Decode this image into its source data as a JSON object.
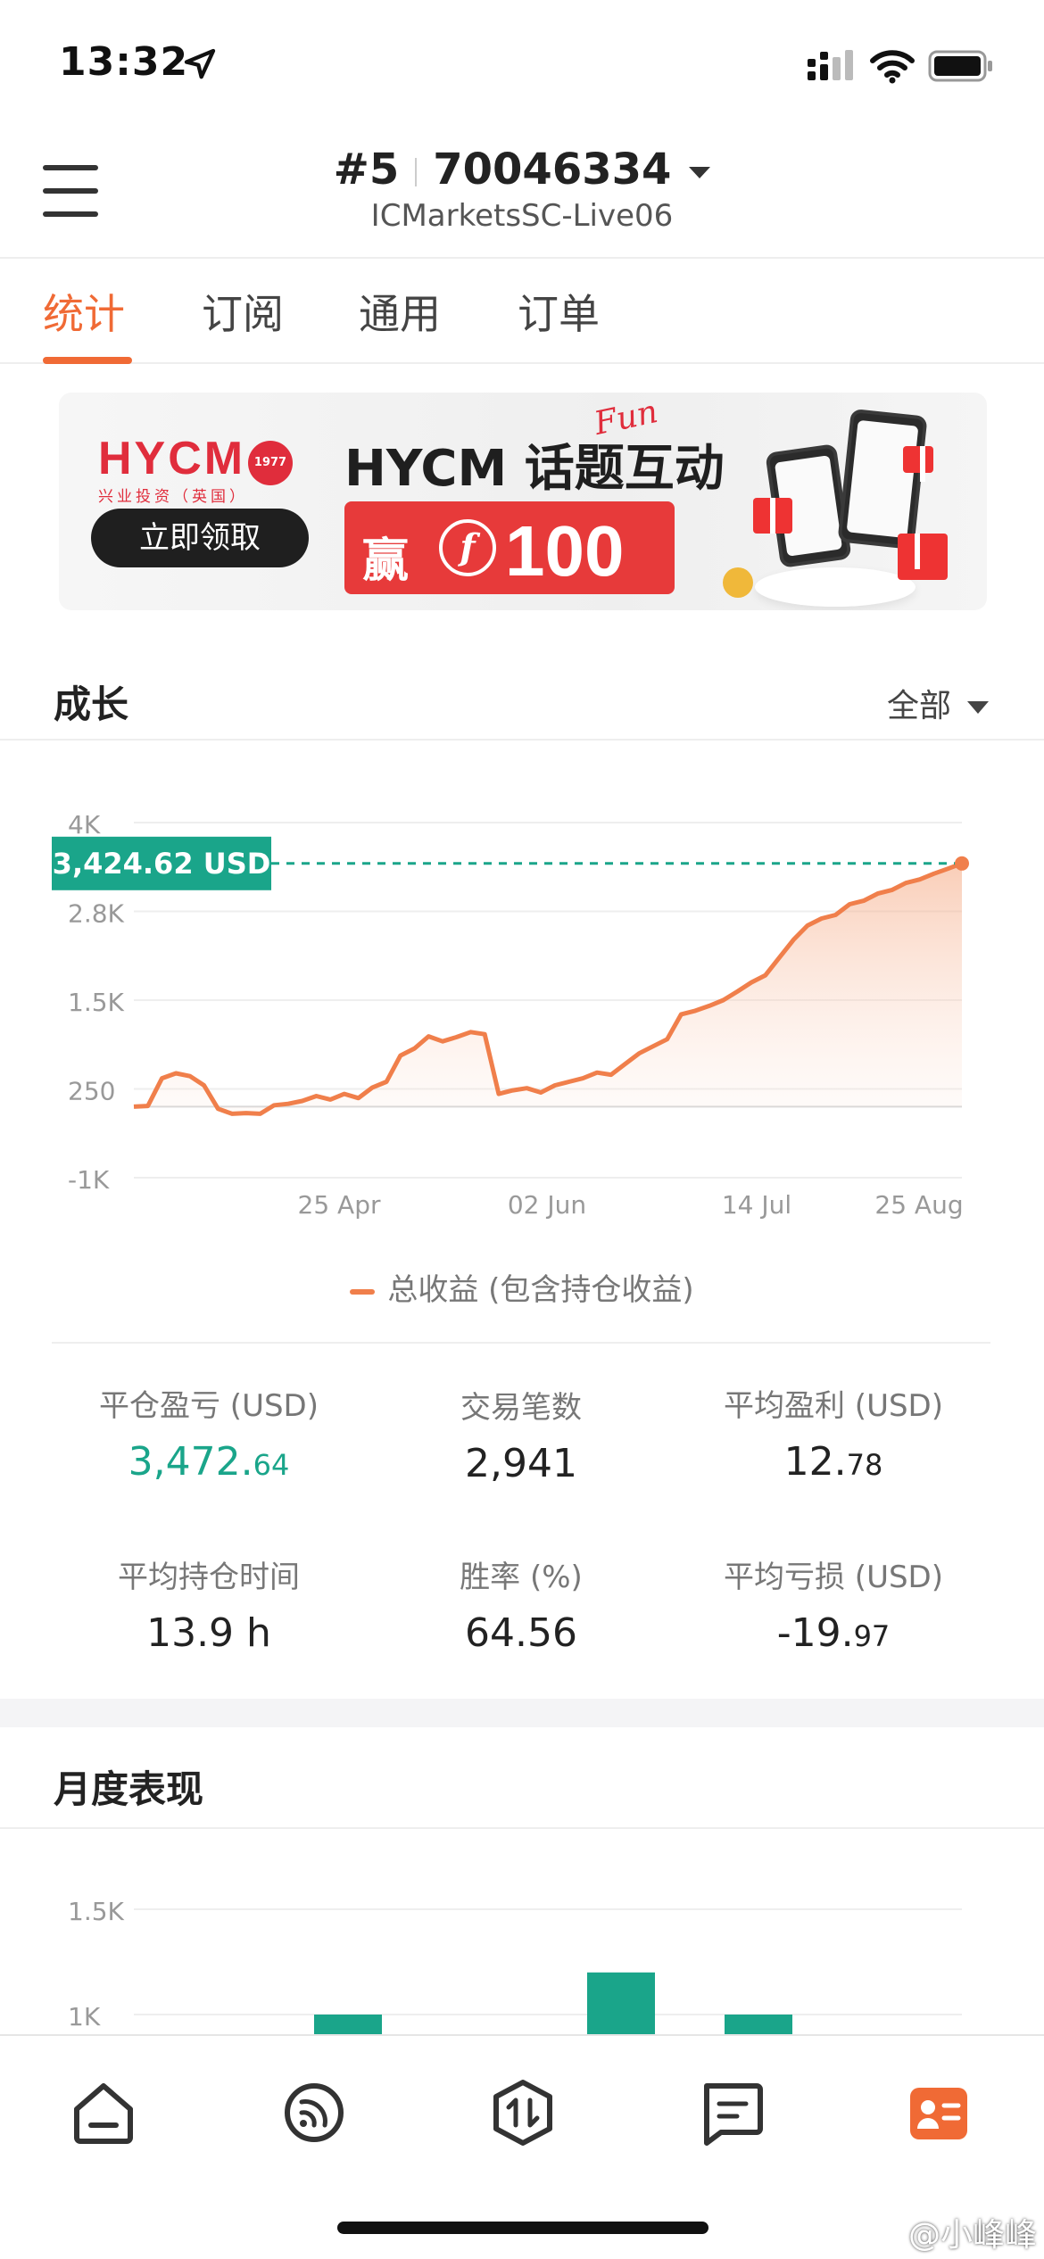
{
  "status_bar": {
    "time": "13:32",
    "icons": [
      "location-arrow-icon",
      "cellular-signal-icon",
      "wifi-icon",
      "battery-icon"
    ]
  },
  "header": {
    "account_index": "#5",
    "account_number": "70046334",
    "server": "ICMarketsSC-Live06"
  },
  "tabs": [
    {
      "label": "统计",
      "active": true
    },
    {
      "label": "订阅",
      "active": false
    },
    {
      "label": "通用",
      "active": false
    },
    {
      "label": "订单",
      "active": false
    }
  ],
  "banner": {
    "brand": "HYCM",
    "brand_sub": "兴业投资（英国）",
    "badge": "1977",
    "button": "立即领取",
    "title": "HYCM 话题互动",
    "script": "Fun",
    "prize_word": "赢",
    "prize_symbol": "f",
    "prize_amount": "100"
  },
  "growth": {
    "title": "成长",
    "filter": "全部"
  },
  "chart_data": [
    {
      "type": "area",
      "title": "",
      "y_ticks": [
        "4K",
        "2.8K",
        "1.5K",
        "250",
        "-1K"
      ],
      "y_tick_values": [
        4000,
        2750,
        1500,
        250,
        -1000
      ],
      "x_ticks": [
        "25 Apr",
        "02 Jun",
        "14 Jul",
        "25 Aug"
      ],
      "ylim": [
        -1000,
        4000
      ],
      "current_label": "3,424.62 USD",
      "current_value": 3424.62,
      "series": [
        {
          "name": "总收益 (包含持仓收益)",
          "color": "#f07f4b",
          "values": [
            0,
            10,
            400,
            470,
            430,
            300,
            -30,
            -100,
            -90,
            -100,
            20,
            40,
            80,
            150,
            100,
            180,
            120,
            270,
            350,
            720,
            820,
            990,
            920,
            980,
            1050,
            1020,
            180,
            230,
            260,
            200,
            300,
            350,
            400,
            480,
            450,
            600,
            750,
            850,
            950,
            1300,
            1350,
            1420,
            1500,
            1620,
            1750,
            1850,
            2100,
            2350,
            2550,
            2650,
            2700,
            2850,
            2900,
            3000,
            3050,
            3150,
            3200,
            3280,
            3350,
            3424.62
          ]
        }
      ],
      "legend": "总收益 (包含持仓收益)"
    },
    {
      "type": "bar",
      "title": "",
      "y_ticks": [
        "1.5K",
        "1K"
      ],
      "y_tick_values": [
        1500,
        1000
      ],
      "series": [
        {
          "name": "",
          "color": "#1aa58a",
          "values": [
            1000,
            1200,
            1000
          ]
        }
      ]
    }
  ],
  "stats": [
    {
      "label": "平仓盈亏 (USD)",
      "value_int": "3,472.",
      "value_dec": "64",
      "green": true
    },
    {
      "label": "交易笔数",
      "value_int": "2,941",
      "value_dec": "",
      "green": false
    },
    {
      "label": "平均盈利 (USD)",
      "value_int": "12.",
      "value_dec": "78",
      "green": false
    },
    {
      "label": "平均持仓时间",
      "value_int": "13.9 h",
      "value_dec": "",
      "green": false
    },
    {
      "label": "胜率 (%)",
      "value_int": "64.56",
      "value_dec": "",
      "green": false
    },
    {
      "label": "平均亏损 (USD)",
      "value_int": "-19.",
      "value_dec": "97",
      "green": false
    }
  ],
  "monthly": {
    "title": "月度表现"
  },
  "bottom_nav": [
    {
      "icon": "home-icon",
      "active": false
    },
    {
      "icon": "signal-feed-icon",
      "active": false
    },
    {
      "icon": "trade-icon",
      "active": false
    },
    {
      "icon": "chat-icon",
      "active": false
    },
    {
      "icon": "profile-card-icon",
      "active": true
    }
  ],
  "watermark": "@小峰峰",
  "colors": {
    "accent": "#f06a35",
    "positive": "#1aa58a",
    "curve": "#f07f4b"
  }
}
